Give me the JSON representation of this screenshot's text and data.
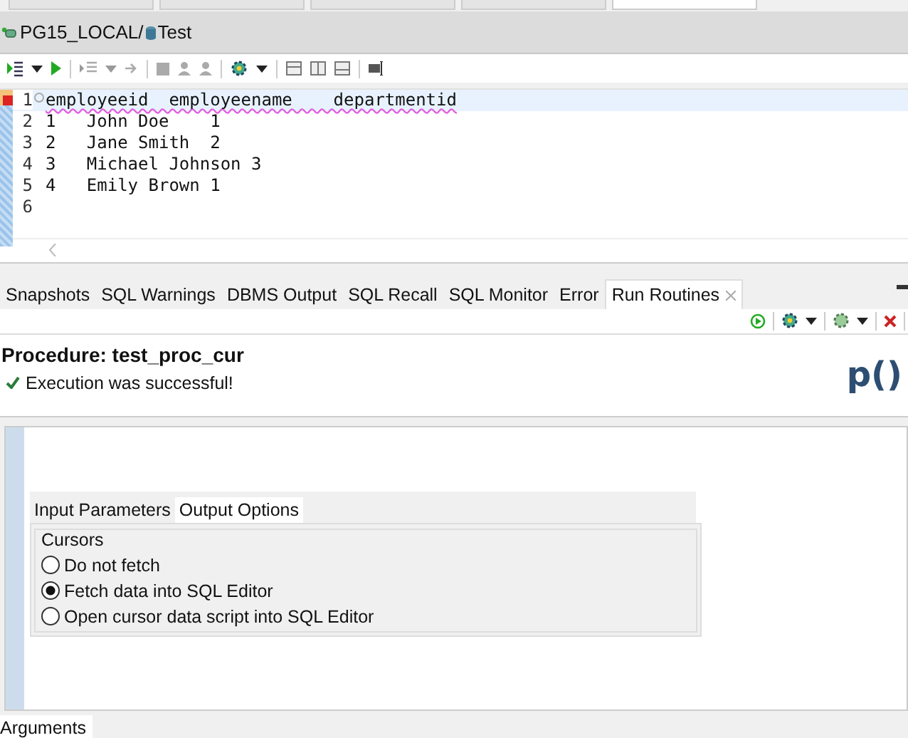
{
  "breadcrumb": {
    "connection": "PG15_LOCAL/",
    "database": "Test"
  },
  "editor": {
    "lines": [
      {
        "number": "1",
        "text": "employeeid  employeename    departmentid",
        "current": true
      },
      {
        "number": "2",
        "text": "1   John Doe    1",
        "current": false
      },
      {
        "number": "3",
        "text": "2   Jane Smith  2",
        "current": false
      },
      {
        "number": "4",
        "text": "3   Michael Johnson 3",
        "current": false
      },
      {
        "number": "5",
        "text": "4   Emily Brown 1",
        "current": false
      },
      {
        "number": "6",
        "current": false
      }
    ]
  },
  "editor_tabs": [
    {
      "selected": false
    },
    {
      "selected": false
    },
    {
      "selected": false
    },
    {
      "selected": false
    },
    {
      "selected": true
    }
  ],
  "view_tabs": [
    {
      "label": "Snapshots",
      "selected": false
    },
    {
      "label": "SQL Warnings",
      "selected": false
    },
    {
      "label": "DBMS Output",
      "selected": false
    },
    {
      "label": "SQL Recall",
      "selected": false
    },
    {
      "label": "SQL Monitor",
      "selected": false
    },
    {
      "label": "Error",
      "selected": false
    },
    {
      "label": "Run Routines",
      "selected": true,
      "closable": true
    }
  ],
  "procedure": {
    "title": "Procedure: test_proc_cur",
    "status": "Execution was successful!",
    "logo": "p()"
  },
  "options_tabs": [
    {
      "label": "Input Parameters",
      "selected": false
    },
    {
      "label": "Output Options",
      "selected": true
    }
  ],
  "cursors": {
    "legend": "Cursors",
    "options": [
      {
        "label": "Do not fetch",
        "selected": false
      },
      {
        "label": "Fetch data into SQL Editor",
        "selected": true
      },
      {
        "label": "Open cursor data script into SQL Editor",
        "selected": false
      }
    ]
  },
  "bottom_tabs": [
    {
      "label": "Arguments",
      "selected": true
    }
  ]
}
